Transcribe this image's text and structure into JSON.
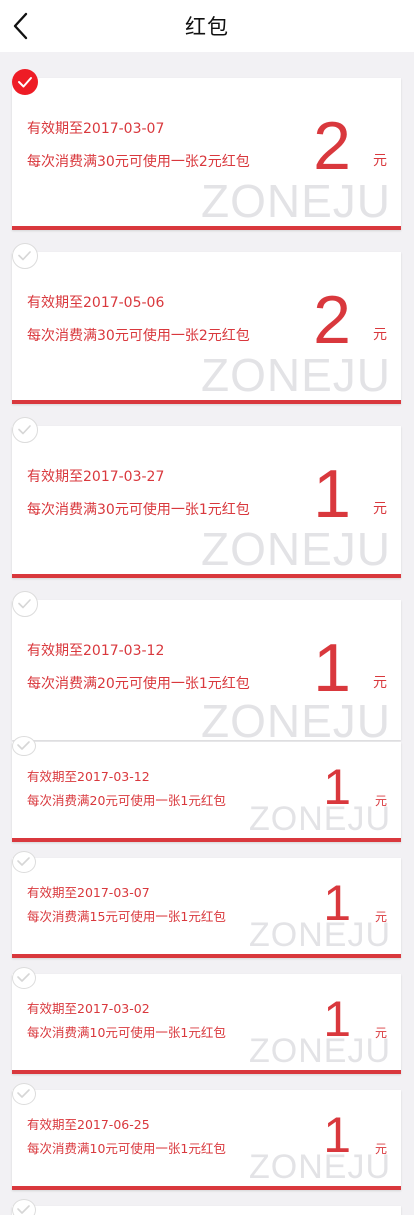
{
  "header": {
    "title": "红包",
    "back_icon": "chevron-left-icon"
  },
  "coupons": [
    {
      "expiry": "有效期至2017-03-07",
      "desc": "每次消费满30元可使用一张2元红包",
      "amount": "2",
      "unit": "元",
      "watermark": "ZONEJU",
      "selected": true
    },
    {
      "expiry": "有效期至2017-05-06",
      "desc": "每次消费满30元可使用一张2元红包",
      "amount": "2",
      "unit": "元",
      "watermark": "ZONEJU",
      "selected": false
    },
    {
      "expiry": "有效期至2017-03-27",
      "desc": "每次消费满30元可使用一张1元红包",
      "amount": "1",
      "unit": "元",
      "watermark": "ZONEJU",
      "selected": false
    },
    {
      "expiry": "有效期至2017-03-12",
      "desc": "每次消费满20元可使用一张1元红包",
      "amount": "1",
      "unit": "元",
      "watermark": "ZONEJU",
      "selected": false
    },
    {
      "expiry": "有效期至2017-03-12",
      "desc": "每次消费满20元可使用一张1元红包",
      "amount": "1",
      "unit": "元",
      "watermark": "ZONEJU",
      "selected": false
    },
    {
      "expiry": "有效期至2017-03-07",
      "desc": "每次消费满15元可使用一张1元红包",
      "amount": "1",
      "unit": "元",
      "watermark": "ZONEJU",
      "selected": false
    },
    {
      "expiry": "有效期至2017-03-02",
      "desc": "每次消费满10元可使用一张1元红包",
      "amount": "1",
      "unit": "元",
      "watermark": "ZONEJU",
      "selected": false
    },
    {
      "expiry": "有效期至2017-06-25",
      "desc": "每次消费满10元可使用一张1元红包",
      "amount": "1",
      "unit": "元",
      "watermark": "ZONEJU",
      "selected": false
    }
  ],
  "colors": {
    "accent": "#d9383d",
    "selected": "#ee1c25",
    "background": "#f2f1f4"
  }
}
